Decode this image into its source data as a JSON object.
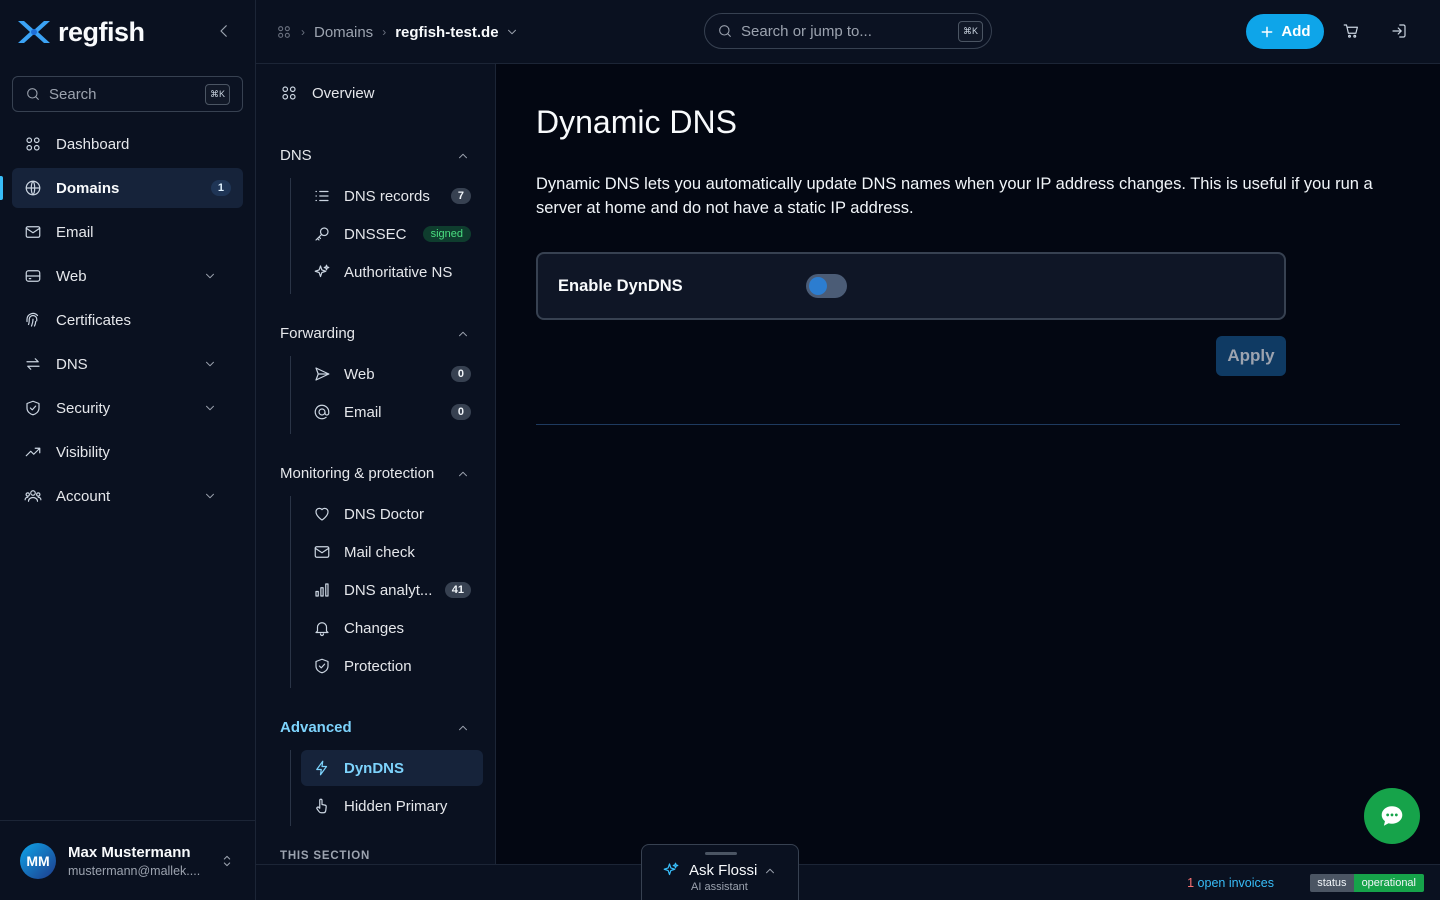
{
  "brand": {
    "name": "regfish"
  },
  "sidebar": {
    "search_label": "Search",
    "shortcut": "⌘K",
    "items": [
      {
        "label": "Dashboard"
      },
      {
        "label": "Domains",
        "badge": "1"
      },
      {
        "label": "Email"
      },
      {
        "label": "Web"
      },
      {
        "label": "Certificates"
      },
      {
        "label": "DNS"
      },
      {
        "label": "Security"
      },
      {
        "label": "Visibility"
      },
      {
        "label": "Account"
      }
    ]
  },
  "user": {
    "initials": "MM",
    "name": "Max Mustermann",
    "email": "mustermann@mallek...."
  },
  "topbar": {
    "breadcrumb": {
      "section": "Domains",
      "current": "regfish-test.de"
    },
    "search_placeholder": "Search or jump to...",
    "shortcut": "⌘K",
    "add_label": "Add"
  },
  "subnav": {
    "overview": "Overview",
    "dns": {
      "title": "DNS",
      "items": [
        {
          "label": "DNS records",
          "badge": "7"
        },
        {
          "label": "DNSSEC",
          "badge": "signed"
        },
        {
          "label": "Authoritative NS"
        }
      ]
    },
    "forwarding": {
      "title": "Forwarding",
      "items": [
        {
          "label": "Web",
          "badge": "0"
        },
        {
          "label": "Email",
          "badge": "0"
        }
      ]
    },
    "monitoring": {
      "title": "Monitoring & protection",
      "items": [
        {
          "label": "DNS Doctor"
        },
        {
          "label": "Mail check"
        },
        {
          "label": "DNS analyt...",
          "badge": "41"
        },
        {
          "label": "Changes"
        },
        {
          "label": "Protection"
        }
      ]
    },
    "advanced": {
      "title": "Advanced",
      "items": [
        {
          "label": "DynDNS"
        },
        {
          "label": "Hidden Primary"
        }
      ]
    },
    "this_section": "THIS SECTION"
  },
  "main": {
    "title": "Dynamic DNS",
    "description": "Dynamic DNS lets you automatically update DNS names when your IP address changes. This is useful if you run a server at home and do not have a static IP address.",
    "toggle_label": "Enable DynDNS",
    "toggle_on": false,
    "apply_label": "Apply"
  },
  "footer": {
    "invoice_count": "1",
    "invoice_text": " open invoices",
    "status_label": "status",
    "status_value": "operational"
  },
  "assistant": {
    "title": "Ask Flossi",
    "subtitle": "AI assistant"
  },
  "colors": {
    "accent": "#0ea5e9",
    "active_text": "#7dd3fc",
    "status_ok": "#16a34a",
    "chat": "#16a34a"
  }
}
